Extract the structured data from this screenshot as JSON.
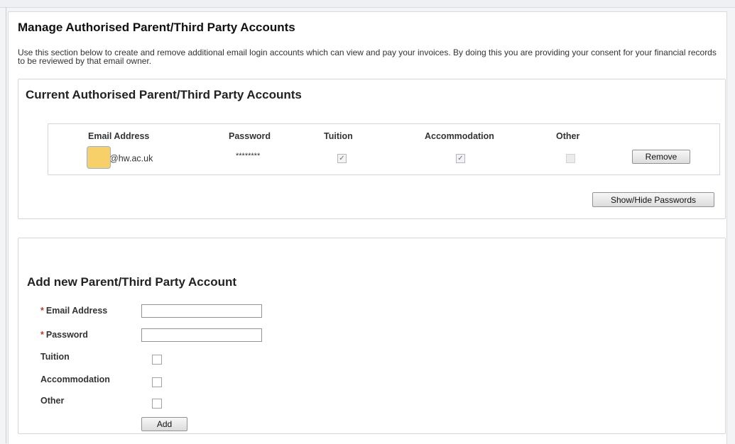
{
  "page": {
    "title": "Manage Authorised Parent/Third Party Accounts",
    "intro": "Use this section below to create and remove additional email login accounts which can view and pay your invoices. By doing this you are providing your consent for your financial records to be reviewed by that email owner."
  },
  "current": {
    "title": "Current Authorised Parent/Third Party Accounts",
    "columns": [
      "Email Address",
      "Password",
      "Tuition",
      "Accommodation",
      "Other"
    ],
    "accounts": [
      {
        "email_visible": "@hw.ac.uk",
        "password": "********",
        "tuition": true,
        "accommodation": true,
        "other": false
      }
    ],
    "remove_label": "Remove",
    "toggle_passwords_label": "Show/Hide Passwords"
  },
  "add": {
    "title": "Add new Parent/Third Party Account",
    "required_marker": "*",
    "email_label": "Email Address",
    "password_label": "Password",
    "tuition_label": "Tuition",
    "accommodation_label": "Accommodation",
    "other_label": "Other",
    "email_value": "",
    "password_value": "",
    "add_label": "Add"
  },
  "icons": {
    "checked": "checkmark-icon"
  }
}
